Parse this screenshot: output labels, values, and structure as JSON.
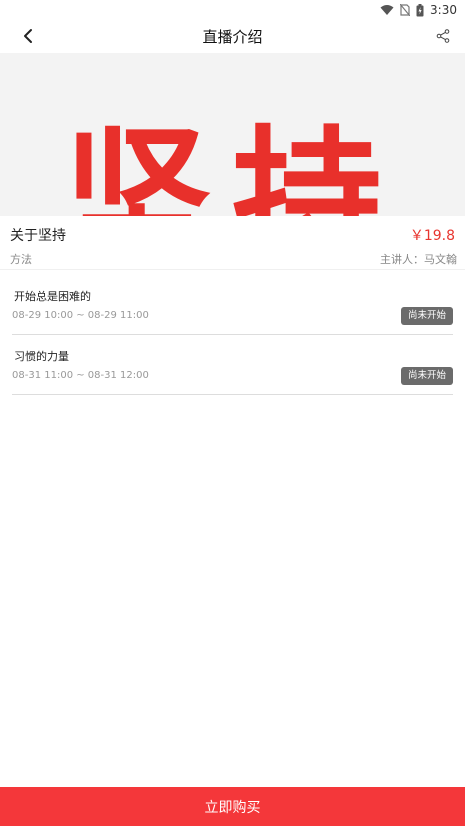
{
  "status_bar": {
    "time": "3:30",
    "icons": [
      "wifi-icon",
      "no-sim-icon",
      "battery-icon"
    ]
  },
  "nav": {
    "title": "直播介绍",
    "back_icon": "back-arrow-icon",
    "share_icon": "share-icon"
  },
  "banner": {
    "text": "坚持",
    "text_color": "#e8302b",
    "background": "#f3f3f3"
  },
  "course": {
    "title": "关于坚持",
    "price": "￥19.8",
    "category": "方法",
    "lecturer": "主讲人：马文翰"
  },
  "lessons": [
    {
      "title": "开始总是困难的",
      "time": "08-29 10:00 ~ 08-29 11:00",
      "status": "尚未开始"
    },
    {
      "title": "习惯的力量",
      "time": "08-31 11:00 ~ 08-31 12:00",
      "status": "尚未开始"
    }
  ],
  "footer": {
    "buy_label": "立即购买"
  },
  "colors": {
    "accent": "#f4373a",
    "price": "#e8352f",
    "status_badge": "#6b6b6b"
  }
}
